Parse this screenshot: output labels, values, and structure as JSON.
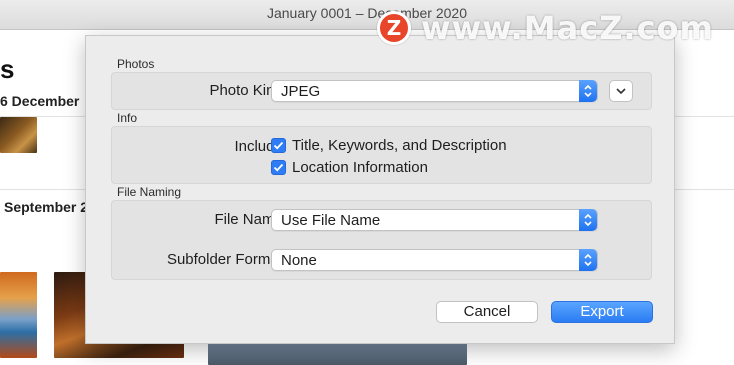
{
  "window": {
    "title": "January 0001 – December 2020"
  },
  "background": {
    "heading": "s",
    "date_1": "6 December",
    "date_2": "September 2"
  },
  "watermark": {
    "badge": "Z",
    "text": "www.MacZ.com"
  },
  "dialog": {
    "photos_section": "Photos",
    "photo_kind_label": "Photo Kind:",
    "photo_kind_value": "JPEG",
    "info_section": "Info",
    "include_label": "Include:",
    "include_options": [
      {
        "label": "Title, Keywords, and Description",
        "checked": true
      },
      {
        "label": "Location Information",
        "checked": true
      }
    ],
    "file_naming_section": "File Naming",
    "file_name_label": "File Name:",
    "file_name_value": "Use File Name",
    "subfolder_label": "Subfolder Format:",
    "subfolder_value": "None",
    "cancel_label": "Cancel",
    "export_label": "Export"
  },
  "colors": {
    "accent": "#2f7df6",
    "watermark_badge": "#e8462b"
  },
  "icons": {
    "stepper": "up-down-chevron-icon",
    "disclosure": "chevron-down-icon",
    "checkbox": "checkmark-icon"
  }
}
